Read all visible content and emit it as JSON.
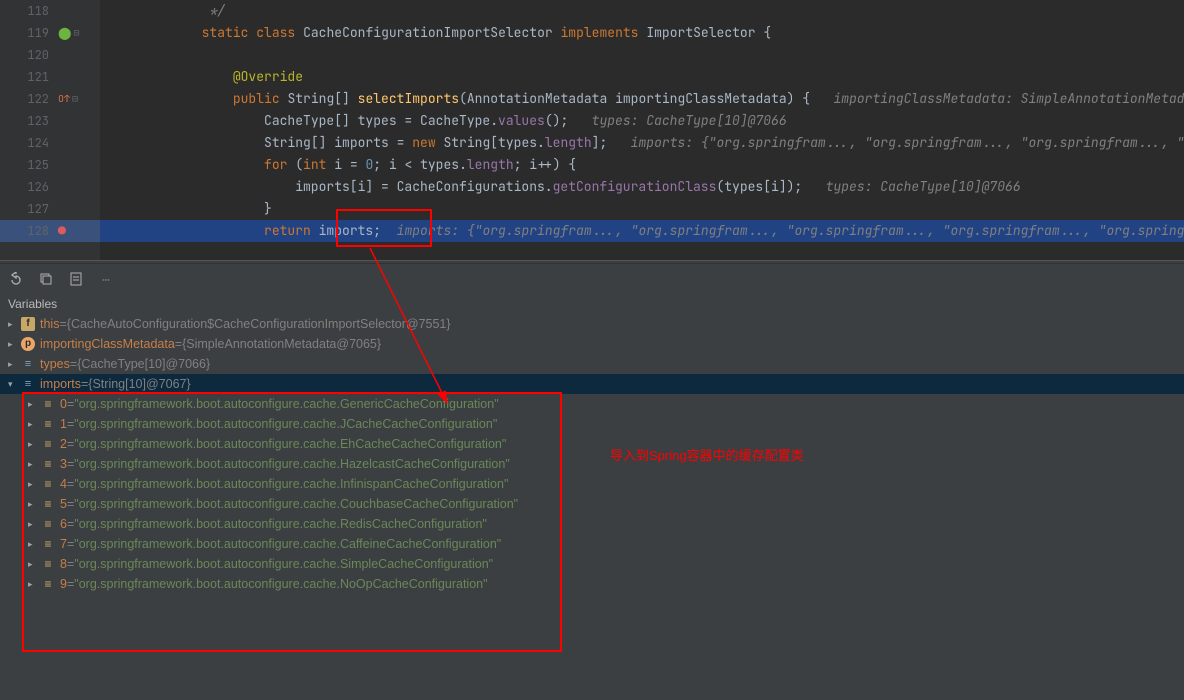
{
  "lines": [
    {
      "n": "118",
      "marks": [],
      "html": "             <span class='cmt'>*/</span>"
    },
    {
      "n": "119",
      "marks": [
        "spring",
        "fold-"
      ],
      "html": "            <span class='kw'>static</span> <span class='kw'>class</span> <span class='type'>CacheConfigurationImportSelector</span> <span class='kw'>implements</span> <span class='type'>ImportSelector</span> <span class='white'>{</span>"
    },
    {
      "n": "120",
      "marks": [],
      "html": ""
    },
    {
      "n": "121",
      "marks": [],
      "html": "                <span class='ann'>@Override</span>"
    },
    {
      "n": "122",
      "marks": [
        "over",
        "fold-"
      ],
      "html": "                <span class='kw'>public</span> <span class='type'>String[]</span> <span class='fn'>selectImports</span>(<span class='type'>AnnotationMetadata</span> importingClassMetadata) {   <span class='cmt'>importingClassMetadata: SimpleAnnotationMetadata</span>"
    },
    {
      "n": "123",
      "marks": [],
      "html": "                    <span class='type'>CacheType[]</span> types = CacheType.<span class='fld'>values</span>();   <span class='cmt'>types: CacheType[10]@7066</span>"
    },
    {
      "n": "124",
      "marks": [],
      "html": "                    <span class='type'>String[]</span> imports = <span class='kw'>new</span> String[types.<span class='fld'>length</span>];   <span class='cmt'>imports: {\"org.springfram..., \"org.springfram..., \"org.springfram..., \"org</span>"
    },
    {
      "n": "125",
      "marks": [],
      "html": "                    <span class='kw'>for</span> (<span class='kw'>int</span> i = <span class='num'>0</span>; i < types.<span class='fld'>length</span>; i++) {"
    },
    {
      "n": "126",
      "marks": [],
      "html": "                        imports[i] = CacheConfigurations.<span class='fld'>getConfigurationClass</span>(types[i]);   <span class='cmt'>types: CacheType[10]@7066</span>"
    },
    {
      "n": "127",
      "marks": [],
      "html": "                    }"
    },
    {
      "n": "128",
      "marks": [
        "bp"
      ],
      "hl": true,
      "html": "                    <span class='kw'>return</span> imports;  <span class='cmt'>imports: {\"org.springfram..., \"org.springfram..., \"org.springfram..., \"org.springfram..., \"org.springfr</span>"
    }
  ],
  "varHeader": "Variables",
  "annotation": "导入到Spring容器中的缓存配置类",
  "vars": {
    "this": {
      "label": "this",
      "val": "{CacheAutoConfiguration$CacheConfigurationImportSelector@7551}"
    },
    "meta": {
      "label": "importingClassMetadata",
      "val": "{SimpleAnnotationMetadata@7065}"
    },
    "types": {
      "label": "types",
      "val": "{CacheType[10]@7066}"
    },
    "imports": {
      "label": "imports",
      "val": "{String[10]@7067}"
    },
    "items": [
      {
        "idx": "0",
        "val": "\"org.springframework.boot.autoconfigure.cache.GenericCacheConfiguration\""
      },
      {
        "idx": "1",
        "val": "\"org.springframework.boot.autoconfigure.cache.JCacheCacheConfiguration\""
      },
      {
        "idx": "2",
        "val": "\"org.springframework.boot.autoconfigure.cache.EhCacheCacheConfiguration\""
      },
      {
        "idx": "3",
        "val": "\"org.springframework.boot.autoconfigure.cache.HazelcastCacheConfiguration\""
      },
      {
        "idx": "4",
        "val": "\"org.springframework.boot.autoconfigure.cache.InfinispanCacheConfiguration\""
      },
      {
        "idx": "5",
        "val": "\"org.springframework.boot.autoconfigure.cache.CouchbaseCacheConfiguration\""
      },
      {
        "idx": "6",
        "val": "\"org.springframework.boot.autoconfigure.cache.RedisCacheConfiguration\""
      },
      {
        "idx": "7",
        "val": "\"org.springframework.boot.autoconfigure.cache.CaffeineCacheConfiguration\""
      },
      {
        "idx": "8",
        "val": "\"org.springframework.boot.autoconfigure.cache.SimpleCacheConfiguration\""
      },
      {
        "idx": "9",
        "val": "\"org.springframework.boot.autoconfigure.cache.NoOpCacheConfiguration\""
      }
    ]
  }
}
